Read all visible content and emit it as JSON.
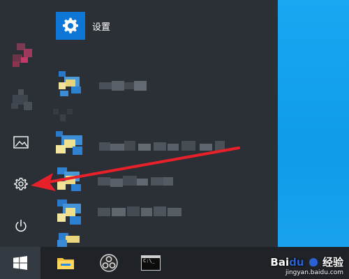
{
  "start_menu": {
    "settings_tile": {
      "label": "设置",
      "icon": "gear-icon",
      "color": "#0e76d6"
    },
    "rail": [
      {
        "name": "user-avatar-icon"
      },
      {
        "name": "documents-icon"
      },
      {
        "name": "pictures-icon"
      },
      {
        "name": "settings-gear-icon"
      },
      {
        "name": "power-icon"
      }
    ]
  },
  "taskbar": {
    "items": [
      {
        "name": "windows-start-icon"
      },
      {
        "name": "file-explorer-icon"
      },
      {
        "name": "obs-studio-icon"
      },
      {
        "name": "command-prompt-icon",
        "label": "C:\\_"
      }
    ]
  },
  "watermark": {
    "brand_a": "Bai",
    "brand_b": "du",
    "brand_c": "经验",
    "url": "jingyan.baidu.com"
  },
  "annotation": {
    "arrow_color": "#e8202a"
  },
  "colors": {
    "desktop": "#15a3f0",
    "menu_bg": "#2b3036",
    "taskbar_bg": "#1f2328",
    "accent": "#0e76d6"
  }
}
